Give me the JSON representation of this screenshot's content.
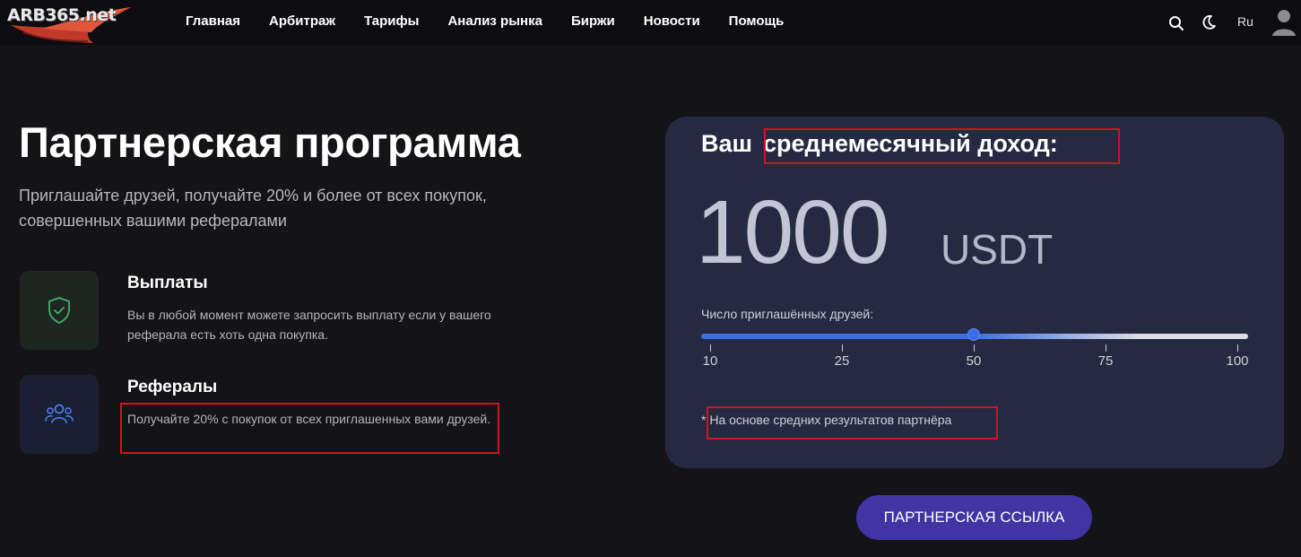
{
  "header": {
    "logo_text": "ARB365.net",
    "nav": [
      "Главная",
      "Арбитраж",
      "Тарифы",
      "Анализ рынка",
      "Биржи",
      "Новости",
      "Помощь"
    ],
    "lang": "Ru",
    "icons": [
      "search-icon",
      "moon-icon",
      "user-icon"
    ]
  },
  "main": {
    "title": "Партнерская программа",
    "subtitle": "Приглашайте друзей, получайте 20% и более от всех покупок, совершенных вашими рефералами",
    "features": [
      {
        "icon": "shield-check-icon",
        "title": "Выплаты",
        "desc": "Вы в любой момент можете запросить выплату если у вашего реферала есть хоть одна покупка."
      },
      {
        "icon": "users-icon",
        "title": "Рефералы",
        "desc": "Получайте 20% с покупок от всех приглашенных вами друзей."
      }
    ]
  },
  "card": {
    "title_prefix": "Ваш",
    "title_highlight": "среднемесячный доход:",
    "amount": "1000",
    "currency": "USDT",
    "slider_label": "Число приглашённых друзей:",
    "slider_ticks": [
      "10",
      "25",
      "50",
      "75",
      "100"
    ],
    "slider_value": 50,
    "slider_min": 10,
    "slider_max": 100,
    "note_star": "*",
    "note": "На основе средних результатов партнёра"
  },
  "cta_label": "ПАРТНЕРСКАЯ ССЫЛКА",
  "colors": {
    "background": "#131318",
    "card": "#252a42",
    "accent": "#3b6ee6",
    "cta": "#4234a3",
    "highlight_border": "#d0141d"
  }
}
